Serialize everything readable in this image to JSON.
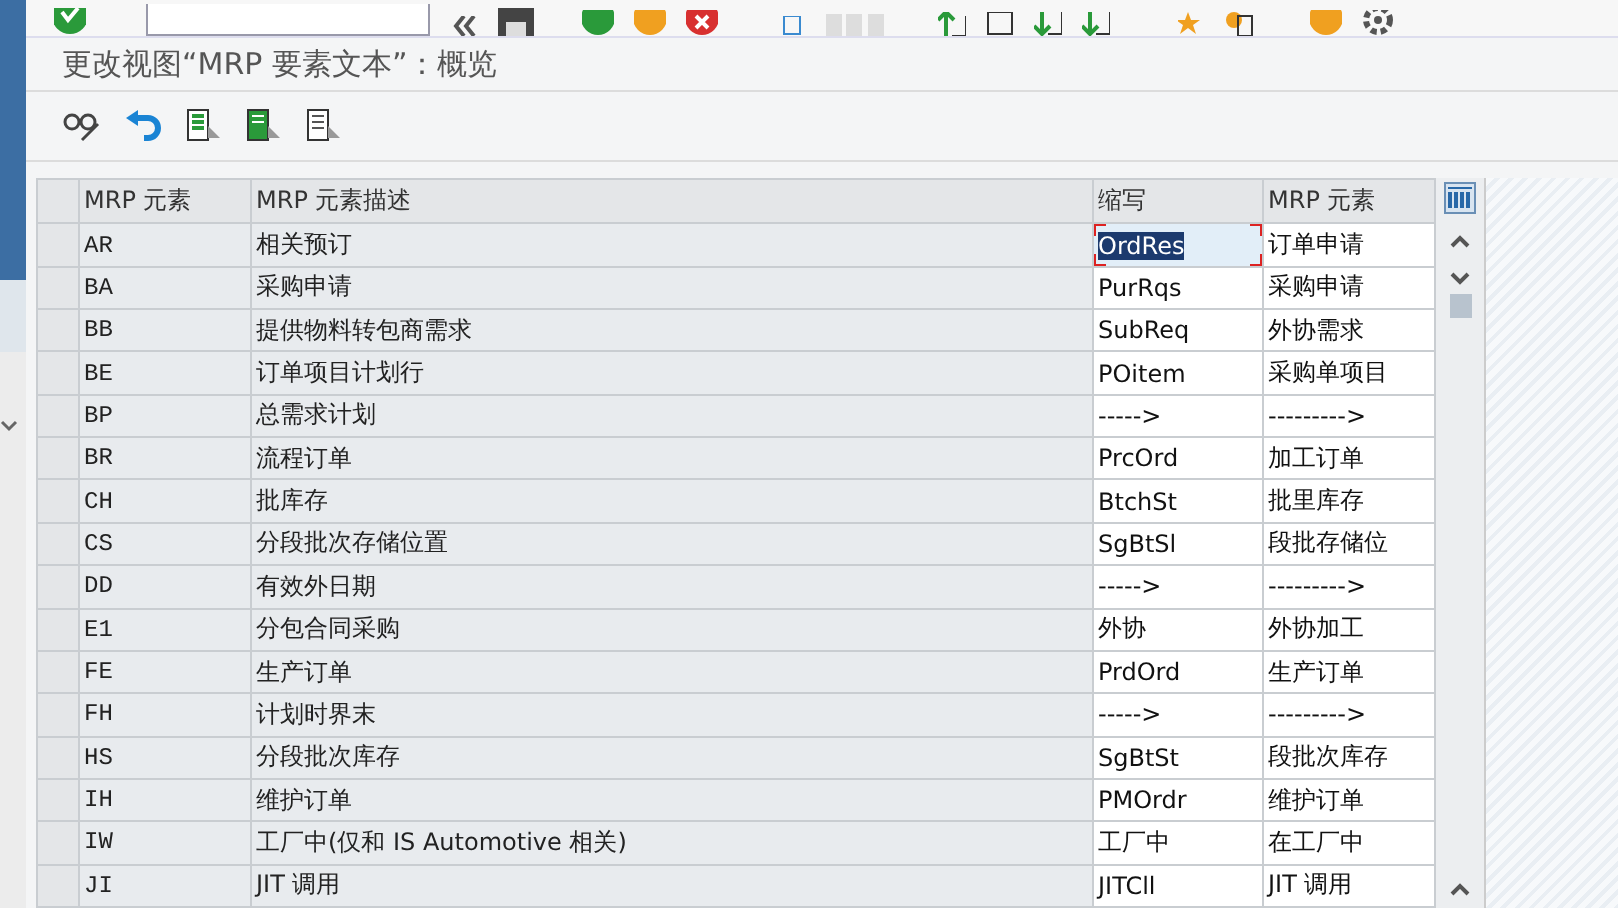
{
  "title": "更改视图“MRP 要素文本”：概览",
  "table": {
    "columns": [
      "MRP 元素",
      "MRP 元素描述",
      "缩写",
      "MRP 元素"
    ],
    "rows": [
      {
        "cells": [
          "AR",
          "相关预订",
          "OrdRes",
          "订单申请"
        ],
        "focused": true
      },
      {
        "cells": [
          "BA",
          "采购申请",
          "PurRqs",
          "采购申请"
        ],
        "focused": false
      },
      {
        "cells": [
          "BB",
          "提供物料转包商需求",
          "SubReq",
          "外协需求"
        ],
        "focused": false
      },
      {
        "cells": [
          "BE",
          "订单项目计划行",
          "POitem",
          "采购单项目"
        ],
        "focused": false
      },
      {
        "cells": [
          "BP",
          "总需求计划",
          "----->",
          "--------->"
        ],
        "focused": false
      },
      {
        "cells": [
          "BR",
          "流程订单",
          "PrcOrd",
          "加工订单"
        ],
        "focused": false
      },
      {
        "cells": [
          "CH",
          "批库存",
          "BtchSt",
          "批里库存"
        ],
        "focused": false
      },
      {
        "cells": [
          "CS",
          "分段批次存储位置",
          "SgBtSl",
          "段批存储位"
        ],
        "focused": false
      },
      {
        "cells": [
          "DD",
          "有效外日期",
          "----->",
          "--------->"
        ],
        "focused": false
      },
      {
        "cells": [
          "E1",
          "分包合同采购",
          "外协",
          "外协加工"
        ],
        "focused": false
      },
      {
        "cells": [
          "FE",
          "生产订单",
          "PrdOrd",
          "生产订单"
        ],
        "focused": false
      },
      {
        "cells": [
          "FH",
          "计划时界末",
          "----->",
          "--------->"
        ],
        "focused": false
      },
      {
        "cells": [
          "HS",
          "分段批次库存",
          "SgBtSt",
          "段批次库存"
        ],
        "focused": false
      },
      {
        "cells": [
          "IH",
          "维护订单",
          "PMOrdr",
          "维护订单"
        ],
        "focused": false
      },
      {
        "cells": [
          "IW",
          "工厂中(仅和 IS Automotive 相关)",
          "工厂中",
          "在工厂中"
        ],
        "focused": false
      },
      {
        "cells": [
          "JI",
          "JIT 调用",
          "JITCll",
          "JIT 调用"
        ],
        "focused": false
      }
    ]
  }
}
